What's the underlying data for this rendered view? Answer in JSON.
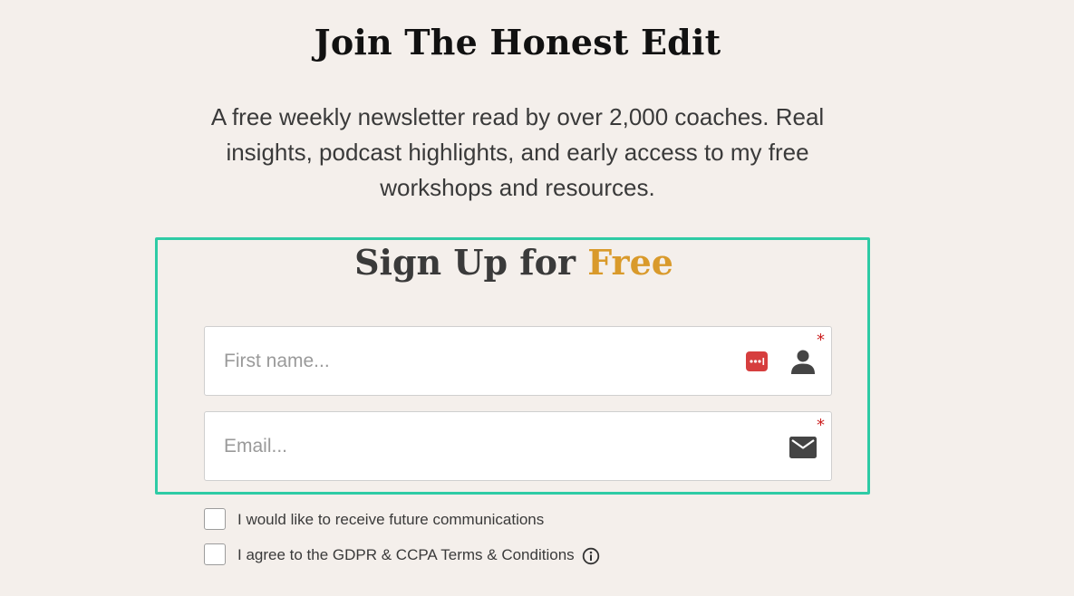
{
  "header": {
    "title": "Join The Honest Edit",
    "subtitle": "A free weekly newsletter read by over 2,000 coaches. Real insights, podcast highlights, and early access to my free workshops and resources."
  },
  "form": {
    "heading_main": "Sign Up for ",
    "heading_accent": "Free",
    "accent_color": "#d99a2b",
    "border_color": "#2ecba5",
    "first_name": {
      "placeholder": "First name...",
      "value": "",
      "required_mark": "*",
      "icons": [
        "password-manager-icon",
        "user-icon"
      ]
    },
    "email": {
      "placeholder": "Email...",
      "value": "",
      "required_mark": "*",
      "icon": "mail-icon"
    }
  },
  "consents": [
    {
      "label": "I would like to receive future communications",
      "checked": false
    },
    {
      "label": "I agree to the GDPR & CCPA Terms & Conditions",
      "checked": false,
      "icon": "info-icon"
    }
  ]
}
